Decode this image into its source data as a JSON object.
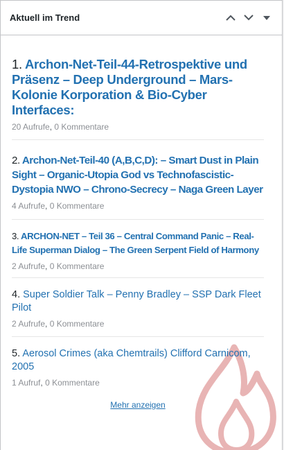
{
  "widget": {
    "title": "Aktuell im Trend",
    "more_label": "Mehr anzeigen"
  },
  "items": [
    {
      "number": "1.",
      "title": "Archon-Net-Teil-44-Retrospektive und Präsenz – Deep Underground – Mars-Kolonie Korporation & Bio-Cyber Interfaces:",
      "views": "20 Aufrufe",
      "comments": "0 Kommentare"
    },
    {
      "number": "2.",
      "title": "Archon-Net-Teil-40 (A,B,C,D): – Smart Dust in Plain Sight – Organic-Utopia God vs Technofascistic-Dystopia NWO – Chrono-Secrecy – Naga Green Layer",
      "views": "4 Aufrufe",
      "comments": "0 Kommentare"
    },
    {
      "number": "3.",
      "title": "ARCHON-NET – Teil 36 – Central Command Panic – Real-Life Superman Dialog – The Green Serpent Field of Harmony",
      "views": "2 Aufrufe",
      "comments": "0 Kommentare"
    },
    {
      "number": "4.",
      "title": "Super Soldier Talk – Penny Bradley – SSP Dark Fleet Pilot",
      "views": "2 Aufrufe",
      "comments": "0 Kommentare"
    },
    {
      "number": "5.",
      "title": "Aerosol Crimes (aka Chemtrails) Clifford Carnicom, 2005",
      "views": "1 Aufruf",
      "comments": "0 Kommentare"
    }
  ],
  "meta_separator": ",",
  "icons": {
    "collapse": "chevron-up-icon",
    "expand": "chevron-down-icon",
    "toggle": "caret-down-icon",
    "watermark": "flame-icon"
  },
  "colors": {
    "link": "#2271b1",
    "text": "#1d2327",
    "muted": "#8c8f94",
    "border": "#c3c4c7",
    "flame": "#e8b4b4"
  }
}
